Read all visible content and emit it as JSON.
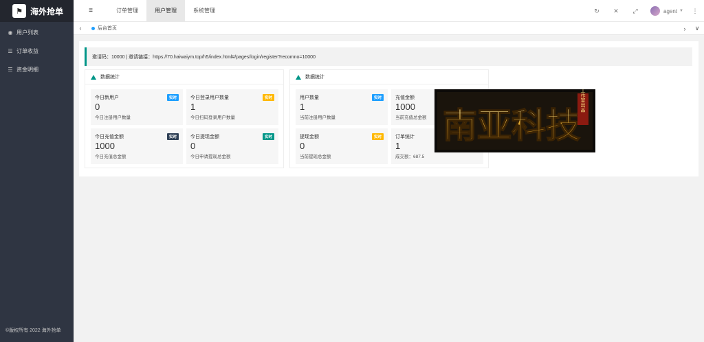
{
  "sidebar": {
    "logo_glyph": "⚑",
    "logo_text": "海外抢单",
    "items": [
      {
        "icon": "users-icon",
        "glyph": "◉",
        "label": "用户列表"
      },
      {
        "icon": "list-icon",
        "glyph": "☰",
        "label": "订单收益"
      },
      {
        "icon": "list-icon",
        "glyph": "☰",
        "label": "资金明细"
      }
    ],
    "copyright": "©版权所有 2022 海外抢单"
  },
  "header": {
    "menu_glyph": "≡",
    "tabs": [
      {
        "label": "订单管理",
        "active": false
      },
      {
        "label": "用户管理",
        "active": true
      },
      {
        "label": "系统管理",
        "active": false
      }
    ],
    "icons": {
      "refresh": "↻",
      "trash": "✕",
      "fullscreen": "⤢",
      "more": "⋮"
    },
    "user": "agent",
    "caret": "▼"
  },
  "tabbar": {
    "prev_glyph": "‹",
    "next_glyph": "›",
    "down_glyph": "∨",
    "page_tab": "后台首页"
  },
  "invite": {
    "text": "邀请码：10000 | 邀请链接：https://70.haiwaiym.top/h5/index.html#/pages/login/register?recomno=10000"
  },
  "panels": [
    {
      "title": "数据统计",
      "stats": [
        {
          "label": "今日新用户",
          "value": "0",
          "sub": "今日注册用户数量",
          "badge": "实时",
          "badge_color": "#1e9fff"
        },
        {
          "label": "今日登录用户数量",
          "value": "1",
          "sub": "今日扫码登录用户数量",
          "badge": "实时",
          "badge_color": "#ffb800"
        },
        {
          "label": "今日充值金额",
          "value": "1000",
          "sub": "今日充值总金额",
          "badge": "实时",
          "badge_color": "#2f4056"
        },
        {
          "label": "今日提现金额",
          "value": "0",
          "sub": "今日申请提现总金额",
          "badge": "实时",
          "badge_color": "#009688"
        }
      ]
    },
    {
      "title": "数据统计",
      "stats": [
        {
          "label": "用户数量",
          "value": "1",
          "sub": "当前注册用户数量",
          "badge": "实时",
          "badge_color": "#1e9fff"
        },
        {
          "label": "充值金额",
          "value": "1000",
          "sub": "当前充值总金额",
          "badge": "",
          "badge_color": "#ffb800"
        },
        {
          "label": "提现金额",
          "value": "0",
          "sub": "当前提现总金额",
          "badge": "实时",
          "badge_color": "#ffb800"
        },
        {
          "label": "订单统计",
          "value": "1",
          "sub": "成交额：687.5",
          "badge": "",
          "badge_color": "#009688"
        }
      ]
    }
  ],
  "watermark": {
    "text": "南亚科技",
    "small_text": "工作室出品"
  }
}
